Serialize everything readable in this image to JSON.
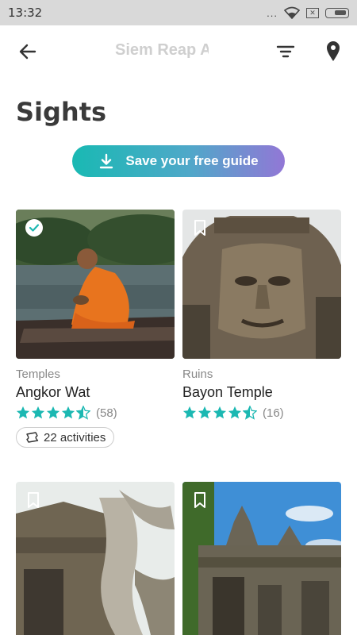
{
  "status_bar": {
    "time": "13:32",
    "dots": "...",
    "sim_icon": "x-box-icon"
  },
  "app_bar": {
    "title": "Siem Reap A"
  },
  "page": {
    "title": "Sights"
  },
  "cta": {
    "label": "Save your free guide"
  },
  "colors": {
    "accent": "#19b9b3",
    "gradient_end": "#9277d6",
    "star": "#1bb8b2"
  },
  "cards": [
    {
      "category": "Temples",
      "name": "Angkor Wat",
      "rating": 4.5,
      "reviews": "(58)",
      "activities": "22 activities",
      "saved": true
    },
    {
      "category": "Ruins",
      "name": "Bayon Temple",
      "rating": 4.5,
      "reviews": "(16)",
      "saved": false
    },
    {
      "category": "",
      "name": "",
      "saved": false
    },
    {
      "category": "",
      "name": "",
      "saved": false
    }
  ]
}
